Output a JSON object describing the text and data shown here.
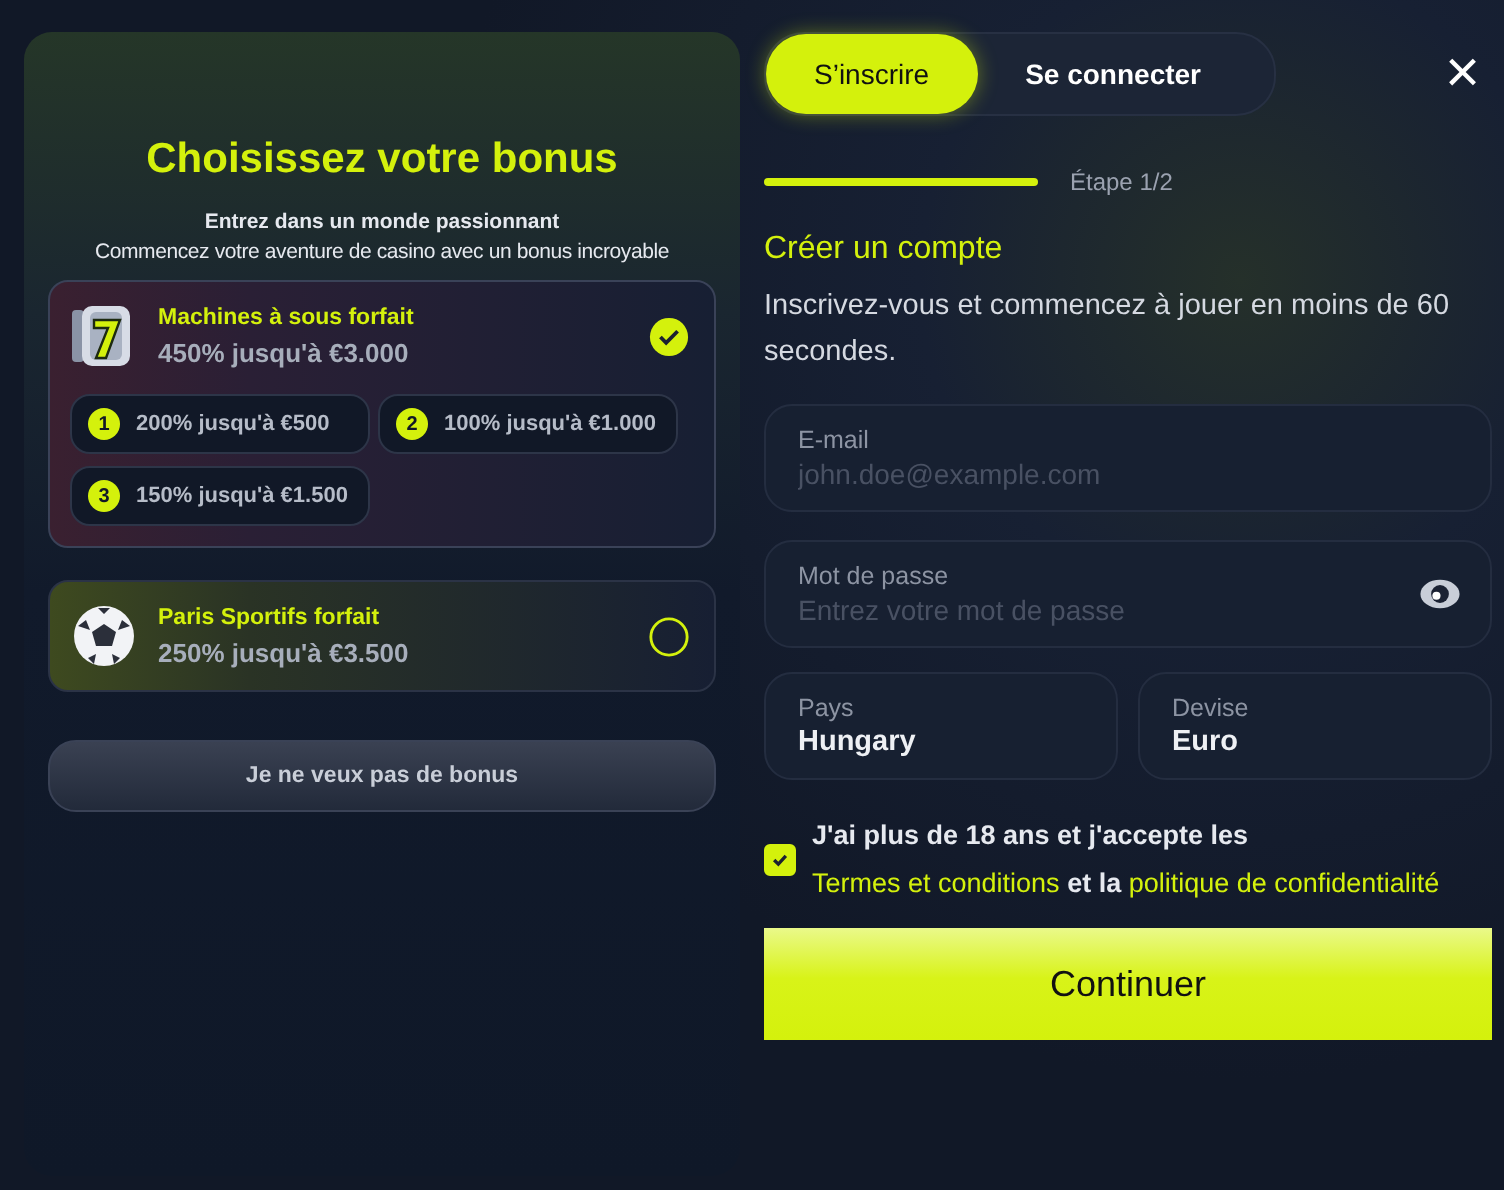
{
  "bonus_panel": {
    "title": "Choisissez votre bonus",
    "subtitle": "Entrez dans un monde passionnant",
    "description": "Commencez votre aventure de casino avec un bonus incroyable",
    "offers": [
      {
        "kind": "slots",
        "title": "Machines à sous forfait",
        "amount": "450% jusqu'à €3.000",
        "selected": true,
        "tiers": [
          {
            "number": "1",
            "text": "200% jusqu'à €500"
          },
          {
            "number": "2",
            "text": "100% jusqu'à €1.000"
          },
          {
            "number": "3",
            "text": "150% jusqu'à €1.500"
          }
        ]
      },
      {
        "kind": "sports",
        "title": "Paris Sportifs forfait",
        "amount": "250% jusqu'à €3.500",
        "selected": false
      }
    ],
    "no_bonus_button": "Je ne veux pas de bonus"
  },
  "tabs": [
    {
      "label": "S’inscrire",
      "selected": true
    },
    {
      "label": "Se connecter",
      "selected": false
    }
  ],
  "close": "×",
  "step": "Étape 1/2",
  "form": {
    "title": "Créer un compte",
    "intro": "Inscrivez-vous et commencez à jouer en moins de 60 secondes.",
    "fields": [
      {
        "kind": "text",
        "label": "E-mail",
        "placeholder": "john.doe@example.com"
      },
      {
        "kind": "password",
        "label": "Mot de passe",
        "placeholder": "Entrez votre mot de passe"
      }
    ],
    "selects": [
      {
        "label": "Pays",
        "value": "Hungary"
      },
      {
        "label": "Devise",
        "value": "Euro"
      }
    ],
    "consent": {
      "checked": true,
      "text_before": "J'ai plus de 18 ans et j'accepte les",
      "terms_link": "Termes et conditions",
      "text_middle": "et la",
      "privacy_link": "politique de confidentialité"
    },
    "submit": "Continuer"
  }
}
